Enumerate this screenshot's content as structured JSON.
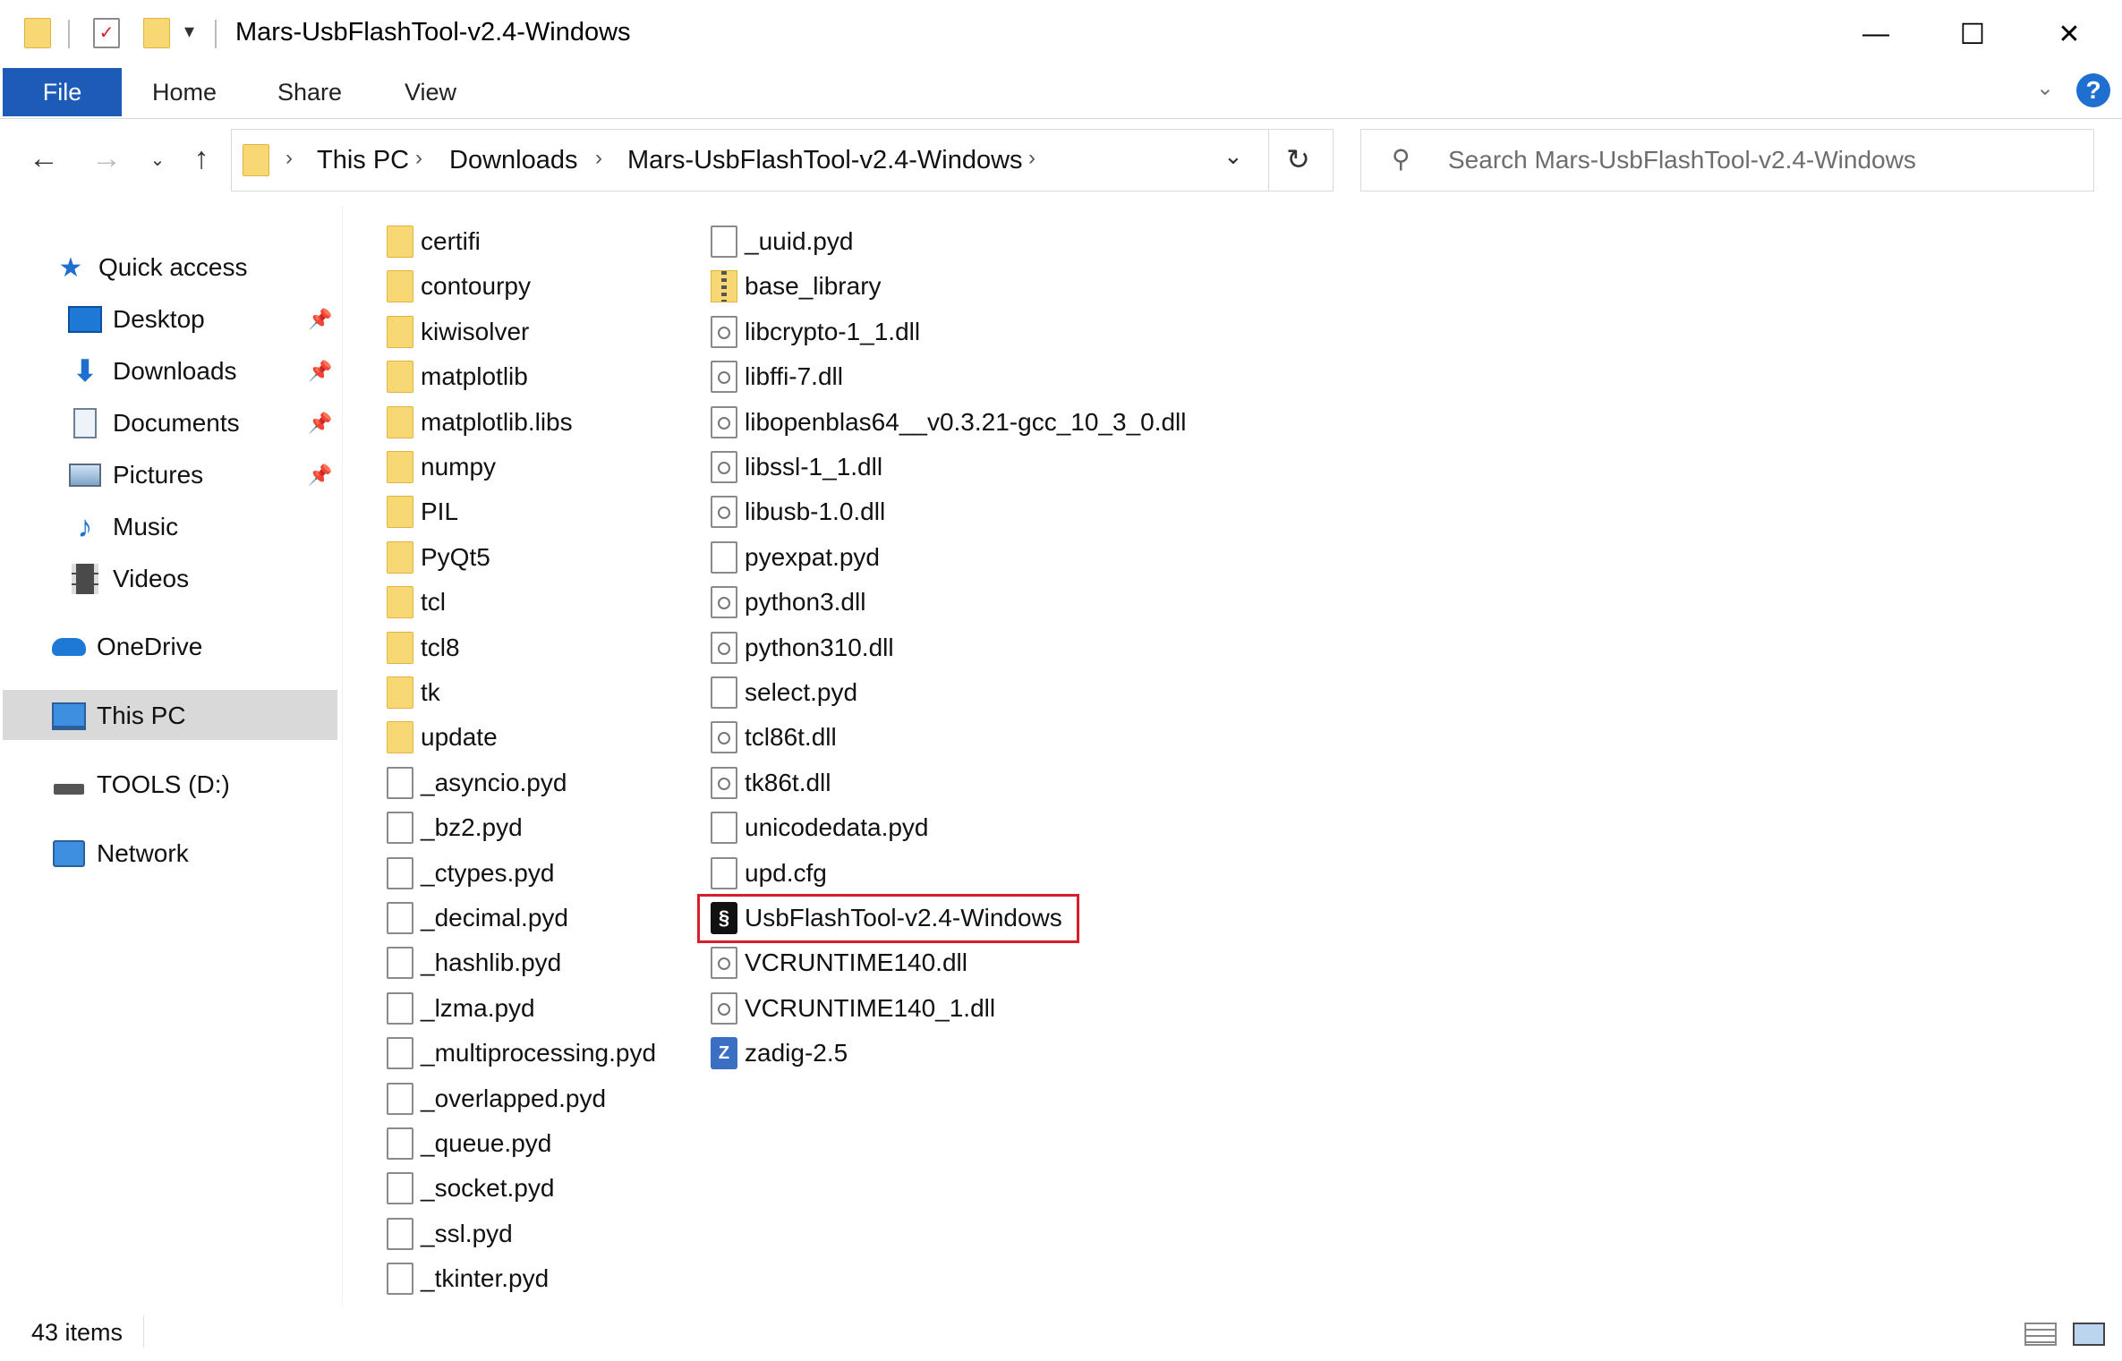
{
  "window": {
    "title": "Mars-UsbFlashTool-v2.4-Windows",
    "controls": {
      "minimize": "—",
      "maximize": "☐",
      "close": "✕"
    }
  },
  "ribbon": {
    "tabs": [
      "File",
      "Home",
      "Share",
      "View"
    ],
    "help": "?"
  },
  "address": {
    "crumbs": [
      "This PC",
      "Downloads",
      "Mars-UsbFlashTool-v2.4-Windows"
    ],
    "search_placeholder": "Search Mars-UsbFlashTool-v2.4-Windows"
  },
  "nav": {
    "quick_access": "Quick access",
    "pinned": [
      "Desktop",
      "Downloads",
      "Documents",
      "Pictures"
    ],
    "unpinned": [
      "Music",
      "Videos"
    ],
    "onedrive": "OneDrive",
    "this_pc": "This PC",
    "drive": "TOOLS (D:)",
    "network": "Network"
  },
  "files": {
    "column1": [
      {
        "name": "certifi",
        "type": "folder"
      },
      {
        "name": "contourpy",
        "type": "folder"
      },
      {
        "name": "kiwisolver",
        "type": "folder"
      },
      {
        "name": "matplotlib",
        "type": "folder"
      },
      {
        "name": "matplotlib.libs",
        "type": "folder"
      },
      {
        "name": "numpy",
        "type": "folder"
      },
      {
        "name": "PIL",
        "type": "folder"
      },
      {
        "name": "PyQt5",
        "type": "folder"
      },
      {
        "name": "tcl",
        "type": "folder"
      },
      {
        "name": "tcl8",
        "type": "folder"
      },
      {
        "name": "tk",
        "type": "folder"
      },
      {
        "name": "update",
        "type": "folder"
      },
      {
        "name": "_asyncio.pyd",
        "type": "file"
      },
      {
        "name": "_bz2.pyd",
        "type": "file"
      },
      {
        "name": "_ctypes.pyd",
        "type": "file"
      },
      {
        "name": "_decimal.pyd",
        "type": "file"
      },
      {
        "name": "_hashlib.pyd",
        "type": "file"
      },
      {
        "name": "_lzma.pyd",
        "type": "file"
      },
      {
        "name": "_multiprocessing.pyd",
        "type": "file"
      },
      {
        "name": "_overlapped.pyd",
        "type": "file"
      },
      {
        "name": "_queue.pyd",
        "type": "file"
      },
      {
        "name": "_socket.pyd",
        "type": "file"
      },
      {
        "name": "_ssl.pyd",
        "type": "file"
      },
      {
        "name": "_tkinter.pyd",
        "type": "file"
      }
    ],
    "column2": [
      {
        "name": "_uuid.pyd",
        "type": "file"
      },
      {
        "name": "base_library",
        "type": "zip"
      },
      {
        "name": "libcrypto-1_1.dll",
        "type": "dll"
      },
      {
        "name": "libffi-7.dll",
        "type": "dll"
      },
      {
        "name": "libopenblas64__v0.3.21-gcc_10_3_0.dll",
        "type": "dll"
      },
      {
        "name": "libssl-1_1.dll",
        "type": "dll"
      },
      {
        "name": "libusb-1.0.dll",
        "type": "dll"
      },
      {
        "name": "pyexpat.pyd",
        "type": "file"
      },
      {
        "name": "python3.dll",
        "type": "dll"
      },
      {
        "name": "python310.dll",
        "type": "dll"
      },
      {
        "name": "select.pyd",
        "type": "file"
      },
      {
        "name": "tcl86t.dll",
        "type": "dll"
      },
      {
        "name": "tk86t.dll",
        "type": "dll"
      },
      {
        "name": "unicodedata.pyd",
        "type": "file"
      },
      {
        "name": "upd.cfg",
        "type": "file"
      },
      {
        "name": "UsbFlashTool-v2.4-Windows",
        "type": "exe"
      },
      {
        "name": "VCRUNTIME140.dll",
        "type": "dll"
      },
      {
        "name": "VCRUNTIME140_1.dll",
        "type": "dll"
      },
      {
        "name": "zadig-2.5",
        "type": "zadig"
      }
    ]
  },
  "status": {
    "count": "43 items"
  },
  "colors": {
    "accent": "#1e5bb8",
    "highlight": "#d81e2a",
    "folder": "#f8d775"
  }
}
